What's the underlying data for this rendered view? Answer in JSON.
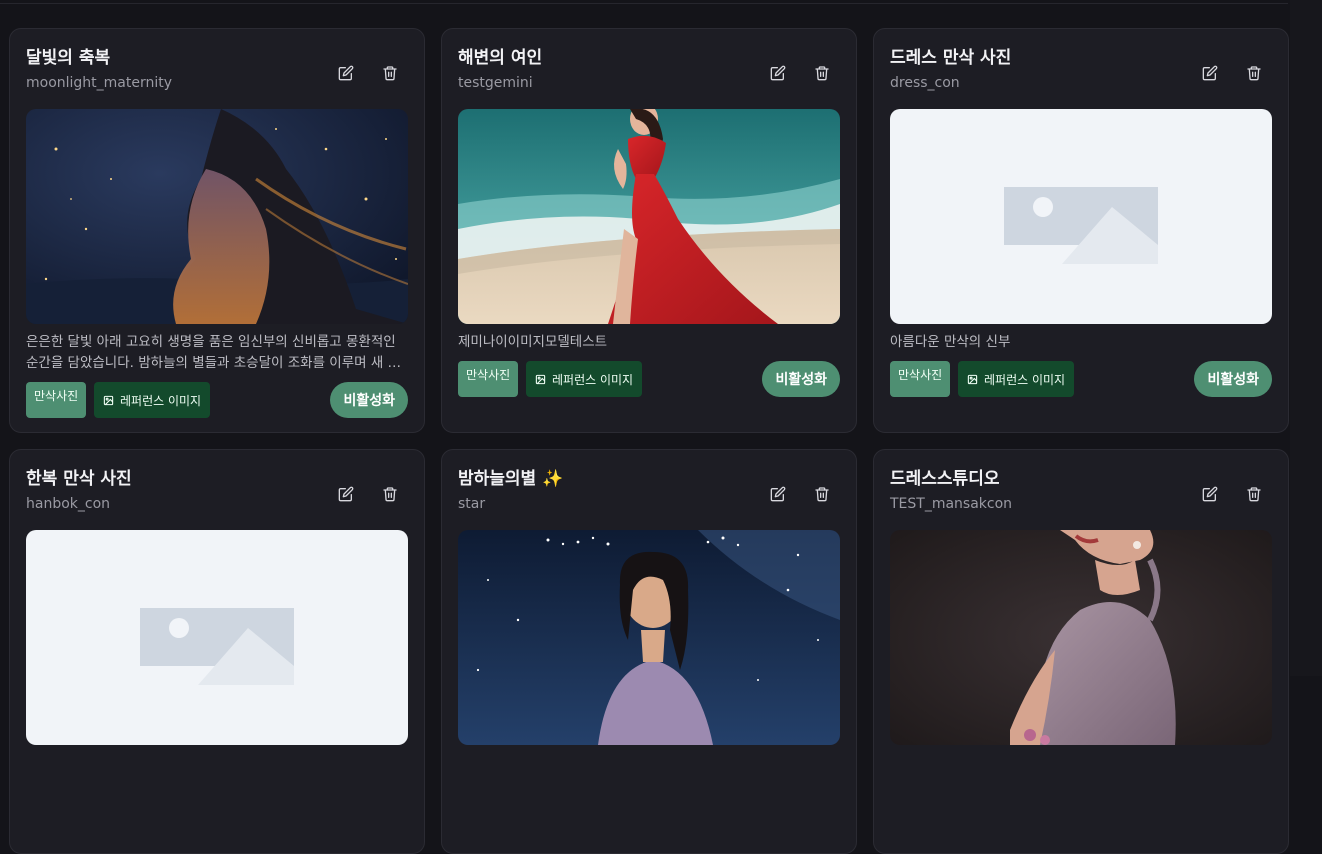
{
  "colors": {
    "background": "#141419",
    "card": "#1d1d24",
    "category_tag": "#4e8f72",
    "reference_tag": "#134a2c",
    "toggle_button": "#4e8f72"
  },
  "icons": {
    "edit": "pencil-square-icon",
    "delete": "trash-icon",
    "reference": "image-icon",
    "placeholder": "image-placeholder-icon"
  },
  "cards": [
    {
      "title": "달빛의 축복",
      "slug": "moonlight_maternity",
      "description": "은은한 달빛 아래 고요히 생명을 품은 임신부의 신비롭고 몽환적인 순간을 담았습니다. 밤하늘의 별들과 초승달이 조화를 이루며 새 생명의 탄생을 축복합니다.",
      "category": "만삭사진",
      "reference_label": "레퍼런스 이미지",
      "toggle_label": "비활성화",
      "image": "moon"
    },
    {
      "title": "해변의 여인",
      "slug": "testgemini",
      "description": "제미나이이미지모델테스트",
      "category": "만삭사진",
      "reference_label": "레퍼런스 이미지",
      "toggle_label": "비활성화",
      "image": "beach"
    },
    {
      "title": "드레스 만삭 사진",
      "slug": "dress_con",
      "description": "아름다운 만삭의 신부",
      "category": "만삭사진",
      "reference_label": "레퍼런스 이미지",
      "toggle_label": "비활성화",
      "image": "placeholder"
    },
    {
      "title": "한복 만삭 사진",
      "slug": "hanbok_con",
      "image": "placeholder"
    },
    {
      "title": "밤하늘의별 ✨",
      "slug": "star",
      "image": "stars"
    },
    {
      "title": "드레스스튜디오",
      "slug": "TEST_mansakcon",
      "image": "studio"
    }
  ]
}
